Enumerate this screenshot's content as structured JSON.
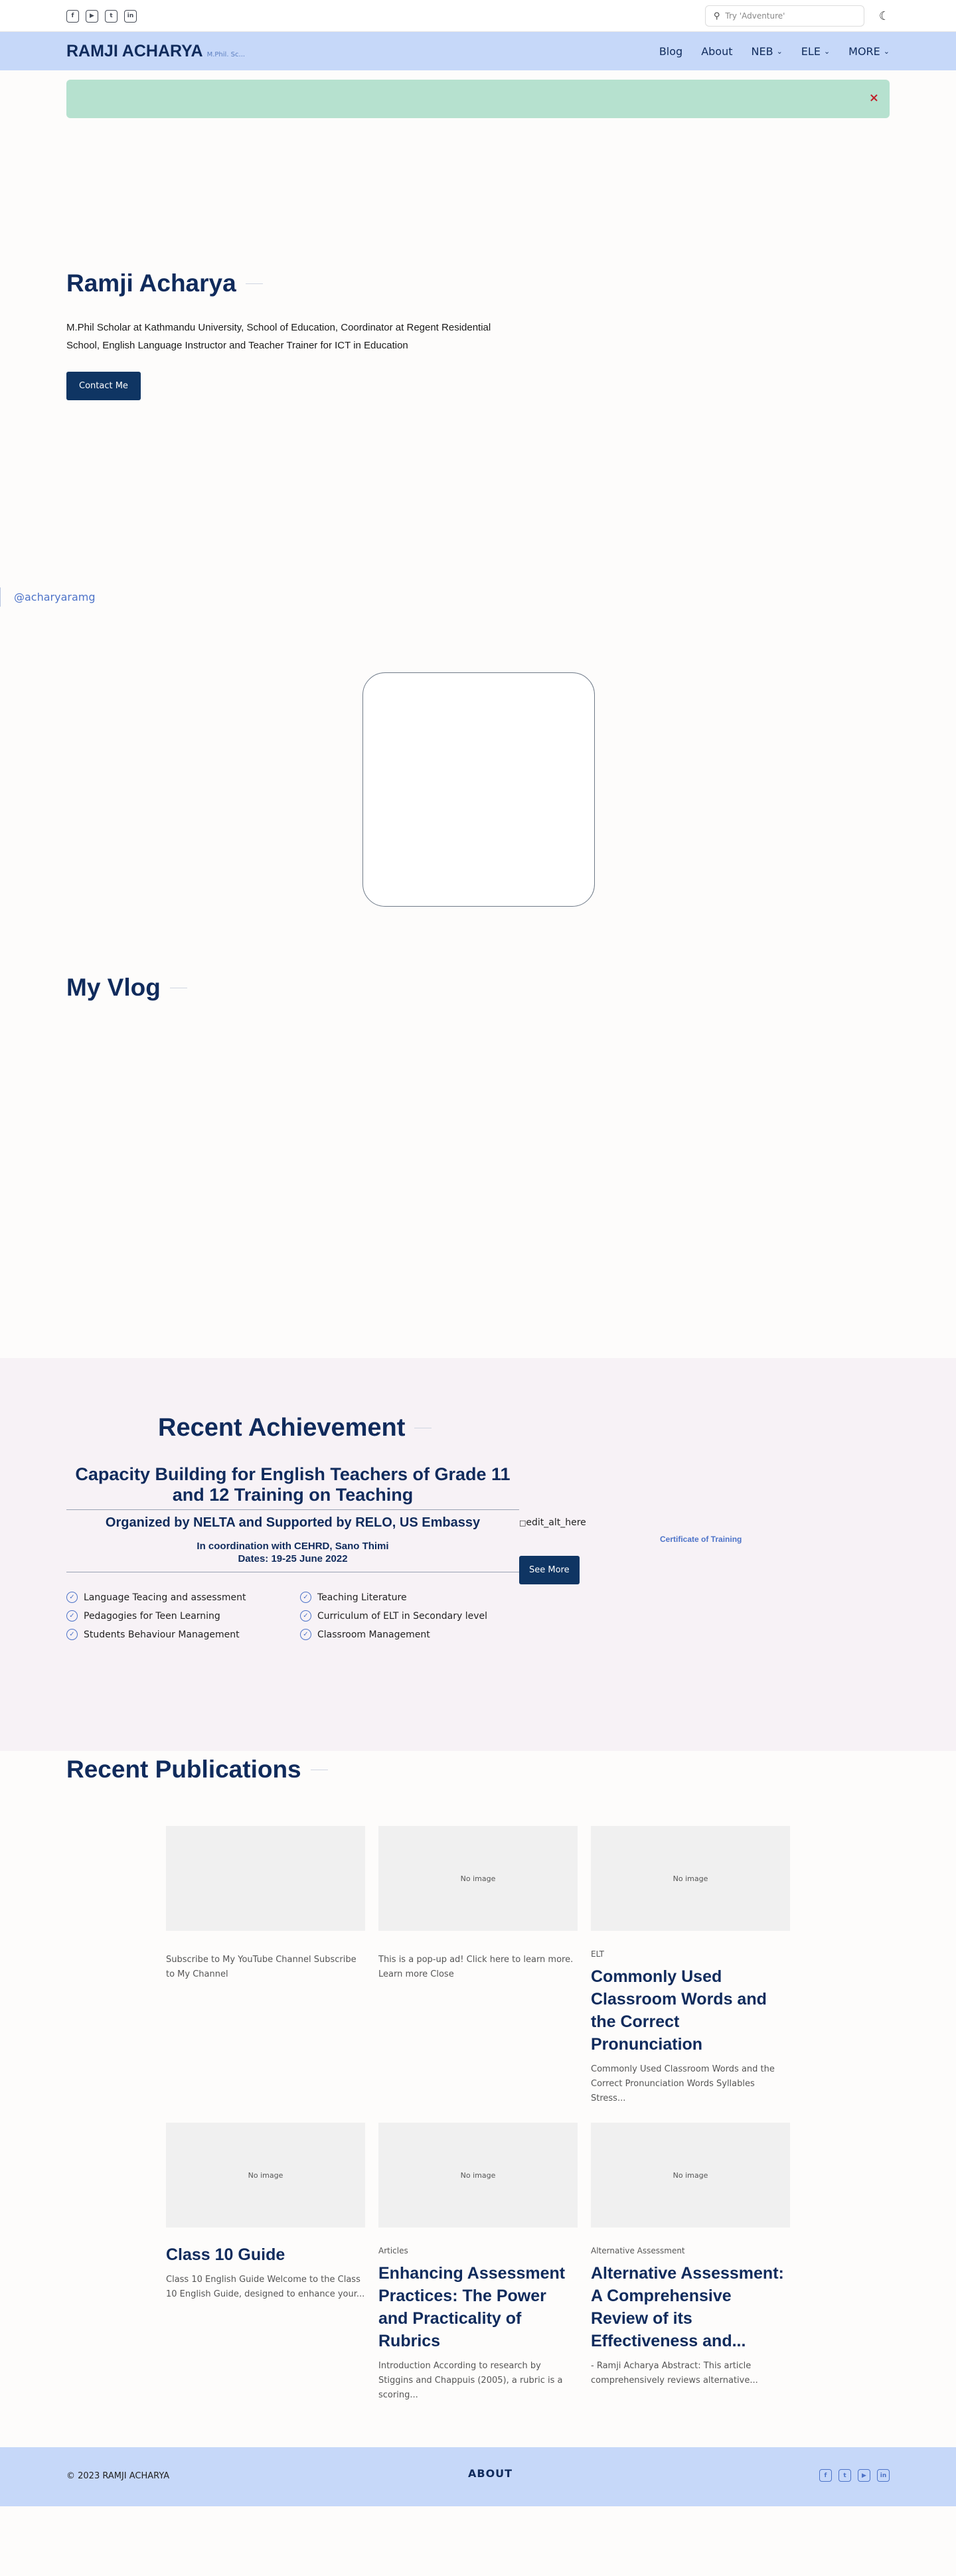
{
  "topbar": {
    "social_icons": [
      "facebook-icon",
      "youtube-icon",
      "twitter-icon",
      "linkedin-icon"
    ],
    "search_placeholder": "Try 'Adventure'"
  },
  "nav": {
    "brand": "RAMJI ACHARYA",
    "tagline": "M.Phil. Sc...",
    "items": [
      {
        "label": "Blog",
        "dropdown": false
      },
      {
        "label": "About",
        "dropdown": false
      },
      {
        "label": "NEB",
        "dropdown": true
      },
      {
        "label": "ELE",
        "dropdown": true
      },
      {
        "label": "MORE",
        "dropdown": true
      }
    ]
  },
  "alert": {
    "close": "×"
  },
  "hero": {
    "name": "Ramji Acharya",
    "bio": "M.Phil Scholar at Kathmandu University, School of Education, Coordinator at Regent Residential School, English Language Instructor and Teacher Trainer for ICT in Education",
    "cta": "Contact Me"
  },
  "handle": "@acharyaramg",
  "vlog": {
    "title": "My Vlog"
  },
  "achievement": {
    "title": "Recent Achievement",
    "headline": "Capacity Building for English Teachers of Grade 11 and 12 Training on Teaching",
    "organizer": "Organized by NELTA and Supported by RELO, US Embassy",
    "coordination": "In coordination with CEHRD, Sano Thimi",
    "dates": "Dates: 19-25 June 2022",
    "features": [
      "Language Teacing and assessment",
      "Teaching Literature",
      "Pedagogies for Teen Learning",
      "Curriculum of ELT in Secondary level",
      "Students Behaviour Management",
      "Classroom Management"
    ],
    "image_alt": "edit_alt_here",
    "see_more": "See More",
    "certificate": "Certificate of Training"
  },
  "publications": {
    "title": "Recent Publications",
    "cards": [
      {
        "thumb": "",
        "category": "",
        "title": "",
        "excerpt": "Subscribe to My YouTube Channel Subscribe to My Channel"
      },
      {
        "thumb": "No image",
        "category": "",
        "title": "",
        "excerpt": "This is a pop-up ad! Click here to learn more. Learn more Close"
      },
      {
        "thumb": "No image",
        "category": "ELT",
        "title": "Commonly Used Classroom Words and the Correct Pronunciation",
        "excerpt": "Commonly Used Classroom Words and the Correct Pronunciation Words Syllables Stress..."
      },
      {
        "thumb": "No image",
        "category": "",
        "title": "Class 10 Guide",
        "excerpt": "Class 10 English Guide Welcome to the Class 10 English Guide, designed to enhance your..."
      },
      {
        "thumb": "No image",
        "category": "Articles",
        "title": "Enhancing Assessment Practices: The Power and Practicality of Rubrics",
        "excerpt": "Introduction According to research by Stiggins and Chappuis (2005), a rubric is a scoring..."
      },
      {
        "thumb": "No image",
        "category": "Alternative Assessment",
        "title": "Alternative Assessment: A Comprehensive Review of its Effectiveness and...",
        "excerpt": "- Ramji Acharya Abstract: This article comprehensively reviews alternative..."
      }
    ]
  },
  "footer": {
    "copyright": "© 2023 RAMJI ACHARYA",
    "about": "ABOUT",
    "social_icons": [
      "facebook-icon",
      "twitter-icon",
      "youtube-icon",
      "linkedin-icon"
    ]
  }
}
